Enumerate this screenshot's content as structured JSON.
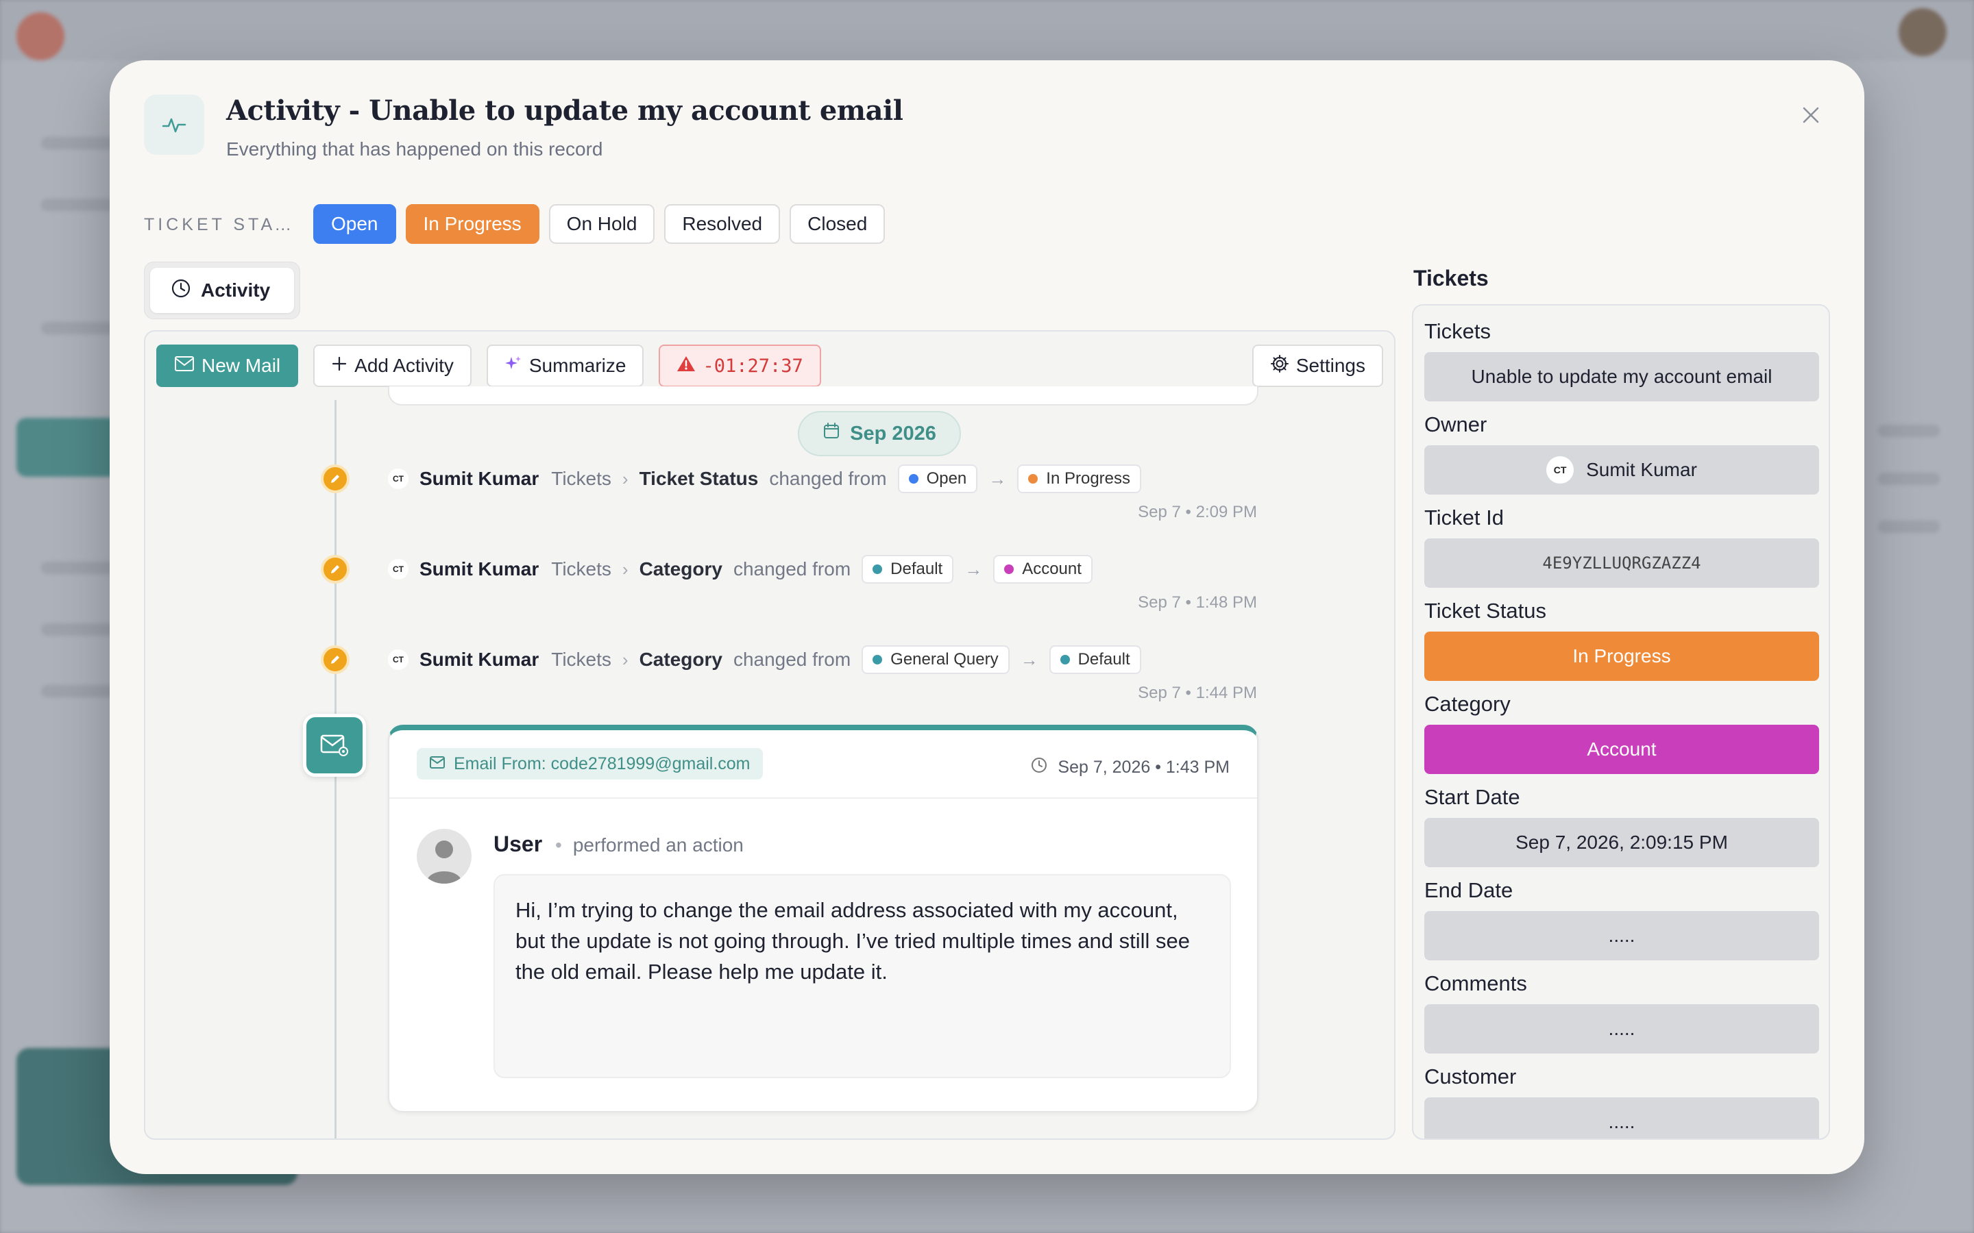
{
  "modal": {
    "title": "Activity - Unable to update my account email",
    "subtitle": "Everything that has happened on this record"
  },
  "status_bar": {
    "label": "TICKET STATUS",
    "options": [
      "Open",
      "In Progress",
      "On Hold",
      "Resolved",
      "Closed"
    ],
    "selected": "In Progress"
  },
  "tabs": [
    {
      "label": "Activity",
      "icon": "clock-icon"
    }
  ],
  "toolbar": {
    "new_mail": "New Mail",
    "add_activity": "Add Activity",
    "summarize": "Summarize",
    "timer": "-01:27:37",
    "settings": "Settings"
  },
  "timeline": {
    "date_group": "Sep 2026",
    "activities": [
      {
        "initials": "CT",
        "user": "Sumit Kumar",
        "module": "Tickets",
        "field": "Ticket Status",
        "verb": "changed from",
        "from": "Open",
        "from_color": "#3d7ff0",
        "to": "In Progress",
        "to_color": "#ee8a3b",
        "time": "Sep 7 • 2:09 PM"
      },
      {
        "initials": "CT",
        "user": "Sumit Kumar",
        "module": "Tickets",
        "field": "Category",
        "verb": "changed from",
        "from": "Default",
        "from_color": "#3b9aa8",
        "to": "Account",
        "to_color": "#c93fbb",
        "time": "Sep 7 • 1:48 PM"
      },
      {
        "initials": "CT",
        "user": "Sumit Kumar",
        "module": "Tickets",
        "field": "Category",
        "verb": "changed from",
        "from": "General Query",
        "from_color": "#3b9aa8",
        "to": "Default",
        "to_color": "#3b9aa8",
        "time": "Sep 7 • 1:44 PM"
      }
    ],
    "email": {
      "from": "Email From: code2781999@gmail.com",
      "date": "Sep 7, 2026 • 1:43 PM",
      "user": "User",
      "action": "performed an action",
      "body": " Hi, I’m trying to change the email address associated with my account, but the update is not going through. I’ve tried multiple times and still see the old email. Please help me update it."
    }
  },
  "sidebar": {
    "title": "Tickets",
    "fields": [
      {
        "label": "Tickets",
        "value": "Unable to update my account email"
      },
      {
        "label": "Owner",
        "value": "Sumit Kumar",
        "initials": "CT"
      },
      {
        "label": "Ticket Id",
        "value": "4E9YZLLUQRGZAZZ4"
      },
      {
        "label": "Ticket Status",
        "value": "In Progress"
      },
      {
        "label": "Category",
        "value": "Account"
      },
      {
        "label": "Start Date",
        "value": "Sep 7, 2026, 2:09:15 PM"
      },
      {
        "label": "End Date",
        "value": "....."
      },
      {
        "label": "Comments",
        "value": "....."
      },
      {
        "label": "Customer",
        "value": "....."
      }
    ]
  },
  "colors": {
    "accent": "#3f9b95",
    "open": "#3d7ff0",
    "in_progress": "#ee8a3b",
    "account": "#c93fbb",
    "timer_alert": "#d33b3b"
  }
}
